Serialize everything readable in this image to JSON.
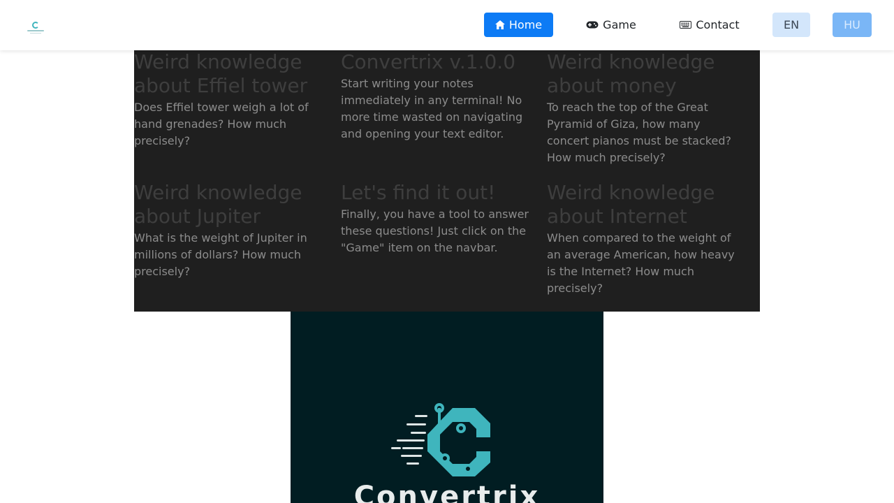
{
  "nav": {
    "home_label": "Home",
    "game_label": "Game",
    "contact_label": "Contact",
    "lang_en": "EN",
    "lang_hu": "HU",
    "home_icon": "home-icon",
    "game_icon": "gamepad-icon",
    "contact_icon": "keyboard-icon",
    "active_color": "#0d7bf5"
  },
  "cards": [
    {
      "title": "Weird knowledge about Effiel tower",
      "text": "Does Effiel tower weigh a lot of hand grenades? How much precisely?"
    },
    {
      "title": "Convertrix v.1.0.0",
      "text": "Start writing your notes immediately in any terminal! No more time wasted on navigating and opening your text editor."
    },
    {
      "title": "Weird knowledge about money",
      "text": "To reach the top of the Great Pyramid of Giza, how many concert pianos must be stacked? How much precisely?"
    },
    {
      "title": "Weird knowledge about Jupiter",
      "text": "What is the weight of Jupiter in millions of dollars? How much precisely?"
    },
    {
      "title": "Let's find it out!",
      "text": "Finally, you have a tool to answer these questions! Just click on the \"Game\" item on the navbar."
    },
    {
      "title": "Weird knowledge about Internet",
      "text": "When compared to the weight of an average American, how heavy is the Internet? How much precisely?"
    }
  ],
  "hero": {
    "name": "Convertrix",
    "logo_color": "#3fb5bd",
    "background": "#011d22"
  }
}
